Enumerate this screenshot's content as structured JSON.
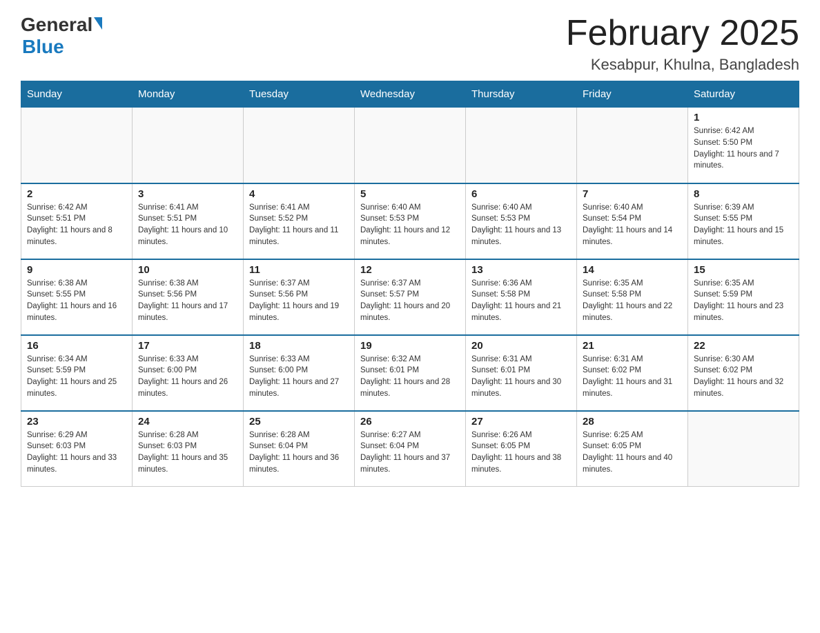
{
  "header": {
    "logo_general": "General",
    "logo_blue": "Blue",
    "month_title": "February 2025",
    "location": "Kesabpur, Khulna, Bangladesh"
  },
  "days_of_week": [
    "Sunday",
    "Monday",
    "Tuesday",
    "Wednesday",
    "Thursday",
    "Friday",
    "Saturday"
  ],
  "weeks": [
    [
      {
        "day": "",
        "info": ""
      },
      {
        "day": "",
        "info": ""
      },
      {
        "day": "",
        "info": ""
      },
      {
        "day": "",
        "info": ""
      },
      {
        "day": "",
        "info": ""
      },
      {
        "day": "",
        "info": ""
      },
      {
        "day": "1",
        "info": "Sunrise: 6:42 AM\nSunset: 5:50 PM\nDaylight: 11 hours and 7 minutes."
      }
    ],
    [
      {
        "day": "2",
        "info": "Sunrise: 6:42 AM\nSunset: 5:51 PM\nDaylight: 11 hours and 8 minutes."
      },
      {
        "day": "3",
        "info": "Sunrise: 6:41 AM\nSunset: 5:51 PM\nDaylight: 11 hours and 10 minutes."
      },
      {
        "day": "4",
        "info": "Sunrise: 6:41 AM\nSunset: 5:52 PM\nDaylight: 11 hours and 11 minutes."
      },
      {
        "day": "5",
        "info": "Sunrise: 6:40 AM\nSunset: 5:53 PM\nDaylight: 11 hours and 12 minutes."
      },
      {
        "day": "6",
        "info": "Sunrise: 6:40 AM\nSunset: 5:53 PM\nDaylight: 11 hours and 13 minutes."
      },
      {
        "day": "7",
        "info": "Sunrise: 6:40 AM\nSunset: 5:54 PM\nDaylight: 11 hours and 14 minutes."
      },
      {
        "day": "8",
        "info": "Sunrise: 6:39 AM\nSunset: 5:55 PM\nDaylight: 11 hours and 15 minutes."
      }
    ],
    [
      {
        "day": "9",
        "info": "Sunrise: 6:38 AM\nSunset: 5:55 PM\nDaylight: 11 hours and 16 minutes."
      },
      {
        "day": "10",
        "info": "Sunrise: 6:38 AM\nSunset: 5:56 PM\nDaylight: 11 hours and 17 minutes."
      },
      {
        "day": "11",
        "info": "Sunrise: 6:37 AM\nSunset: 5:56 PM\nDaylight: 11 hours and 19 minutes."
      },
      {
        "day": "12",
        "info": "Sunrise: 6:37 AM\nSunset: 5:57 PM\nDaylight: 11 hours and 20 minutes."
      },
      {
        "day": "13",
        "info": "Sunrise: 6:36 AM\nSunset: 5:58 PM\nDaylight: 11 hours and 21 minutes."
      },
      {
        "day": "14",
        "info": "Sunrise: 6:35 AM\nSunset: 5:58 PM\nDaylight: 11 hours and 22 minutes."
      },
      {
        "day": "15",
        "info": "Sunrise: 6:35 AM\nSunset: 5:59 PM\nDaylight: 11 hours and 23 minutes."
      }
    ],
    [
      {
        "day": "16",
        "info": "Sunrise: 6:34 AM\nSunset: 5:59 PM\nDaylight: 11 hours and 25 minutes."
      },
      {
        "day": "17",
        "info": "Sunrise: 6:33 AM\nSunset: 6:00 PM\nDaylight: 11 hours and 26 minutes."
      },
      {
        "day": "18",
        "info": "Sunrise: 6:33 AM\nSunset: 6:00 PM\nDaylight: 11 hours and 27 minutes."
      },
      {
        "day": "19",
        "info": "Sunrise: 6:32 AM\nSunset: 6:01 PM\nDaylight: 11 hours and 28 minutes."
      },
      {
        "day": "20",
        "info": "Sunrise: 6:31 AM\nSunset: 6:01 PM\nDaylight: 11 hours and 30 minutes."
      },
      {
        "day": "21",
        "info": "Sunrise: 6:31 AM\nSunset: 6:02 PM\nDaylight: 11 hours and 31 minutes."
      },
      {
        "day": "22",
        "info": "Sunrise: 6:30 AM\nSunset: 6:02 PM\nDaylight: 11 hours and 32 minutes."
      }
    ],
    [
      {
        "day": "23",
        "info": "Sunrise: 6:29 AM\nSunset: 6:03 PM\nDaylight: 11 hours and 33 minutes."
      },
      {
        "day": "24",
        "info": "Sunrise: 6:28 AM\nSunset: 6:03 PM\nDaylight: 11 hours and 35 minutes."
      },
      {
        "day": "25",
        "info": "Sunrise: 6:28 AM\nSunset: 6:04 PM\nDaylight: 11 hours and 36 minutes."
      },
      {
        "day": "26",
        "info": "Sunrise: 6:27 AM\nSunset: 6:04 PM\nDaylight: 11 hours and 37 minutes."
      },
      {
        "day": "27",
        "info": "Sunrise: 6:26 AM\nSunset: 6:05 PM\nDaylight: 11 hours and 38 minutes."
      },
      {
        "day": "28",
        "info": "Sunrise: 6:25 AM\nSunset: 6:05 PM\nDaylight: 11 hours and 40 minutes."
      },
      {
        "day": "",
        "info": ""
      }
    ]
  ]
}
